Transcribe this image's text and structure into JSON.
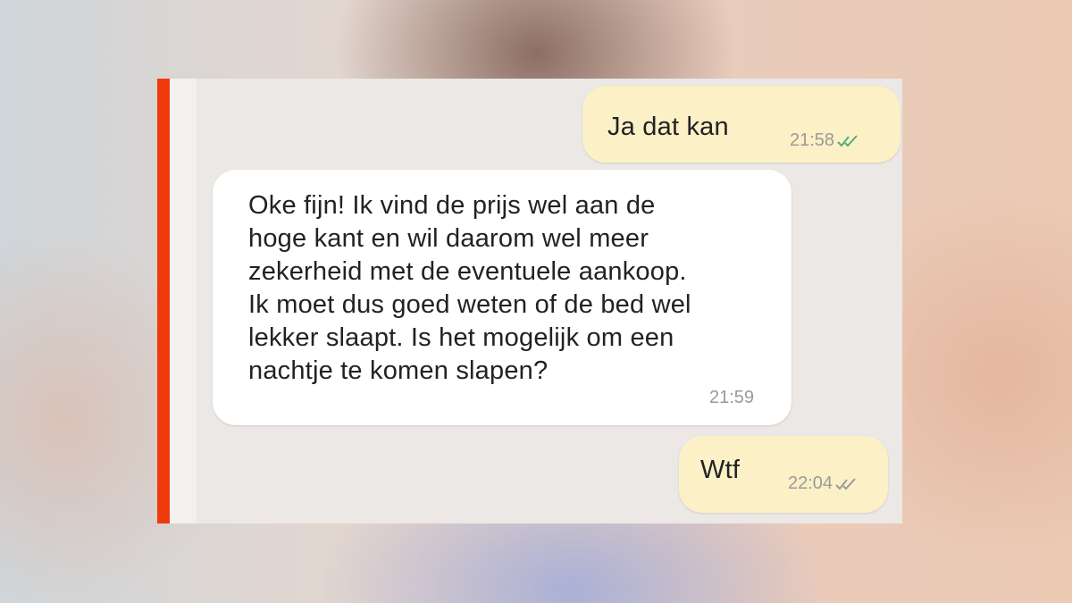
{
  "messages": [
    {
      "direction": "outgoing",
      "text": "Ja dat kan",
      "time": "21:58",
      "status": "read",
      "status_icon": "double-check-icon"
    },
    {
      "direction": "incoming",
      "text": "Oke fijn! Ik vind de prijs wel aan de\nhoge kant en wil daarom wel meer\nzekerheid met de eventuele aankoop.\nIk moet dus goed weten of de bed wel\nlekker slaapt. Is het mogelijk om een\nnachtje te komen slapen?",
      "time": "21:59"
    },
    {
      "direction": "outgoing",
      "text": "Wtf",
      "time": "22:04",
      "status": "delivered",
      "status_icon": "double-check-icon"
    }
  ],
  "colors": {
    "accent": "#f03a0d",
    "outgoing_bubble": "#fbf0c6",
    "incoming_bubble": "#ffffff",
    "read_tick": "#4fae7a",
    "unread_tick": "#9a9a9a"
  }
}
